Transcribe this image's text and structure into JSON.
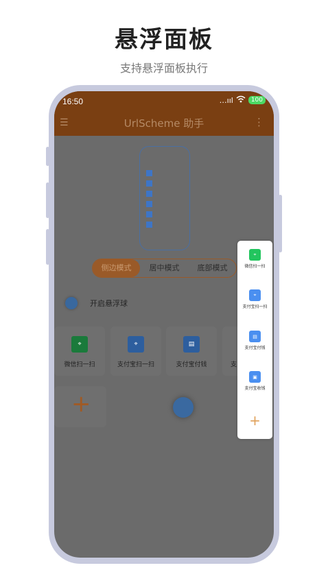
{
  "hero": {
    "title": "悬浮面板",
    "subtitle": "支持悬浮面板执行"
  },
  "status": {
    "time": "16:50",
    "signal": "…ııl",
    "battery": "100"
  },
  "appbar": {
    "title": "UrlScheme 助手",
    "menu_icon": "☰",
    "more_icon": "⋮"
  },
  "modes": [
    {
      "label": "侧边模式",
      "active": true
    },
    {
      "label": "居中模式",
      "active": false
    },
    {
      "label": "底部模式",
      "active": false
    }
  ],
  "toggle": {
    "label": "开启悬浮球"
  },
  "cards": [
    {
      "label": "微信扫一扫",
      "icon": "wechat-scan-icon",
      "color": "#1a7a3b"
    },
    {
      "label": "支付宝扫一扫",
      "icon": "alipay-scan-icon",
      "color": "#2d5e9e"
    },
    {
      "label": "支付宝付钱",
      "icon": "alipay-pay-icon",
      "color": "#2d5e9e"
    },
    {
      "label": "支",
      "icon": "",
      "color": "#6f6f6f"
    }
  ],
  "add_label": "+",
  "panel": {
    "items": [
      {
        "label": "微信扫一扫",
        "icon": "wechat-scan-icon",
        "color": "#22c55e"
      },
      {
        "label": "支付宝扫一扫",
        "icon": "alipay-scan-icon",
        "color": "#4a8ff0"
      },
      {
        "label": "支付宝付钱",
        "icon": "alipay-pay-icon",
        "color": "#4a8ff0"
      },
      {
        "label": "支付宝收钱",
        "icon": "alipay-receive-icon",
        "color": "#4a8ff0"
      }
    ],
    "add_label": "+"
  },
  "colors": {
    "brand": "#7a3f12",
    "accent": "#9a5a28",
    "phone_frame": "#c7cade"
  }
}
